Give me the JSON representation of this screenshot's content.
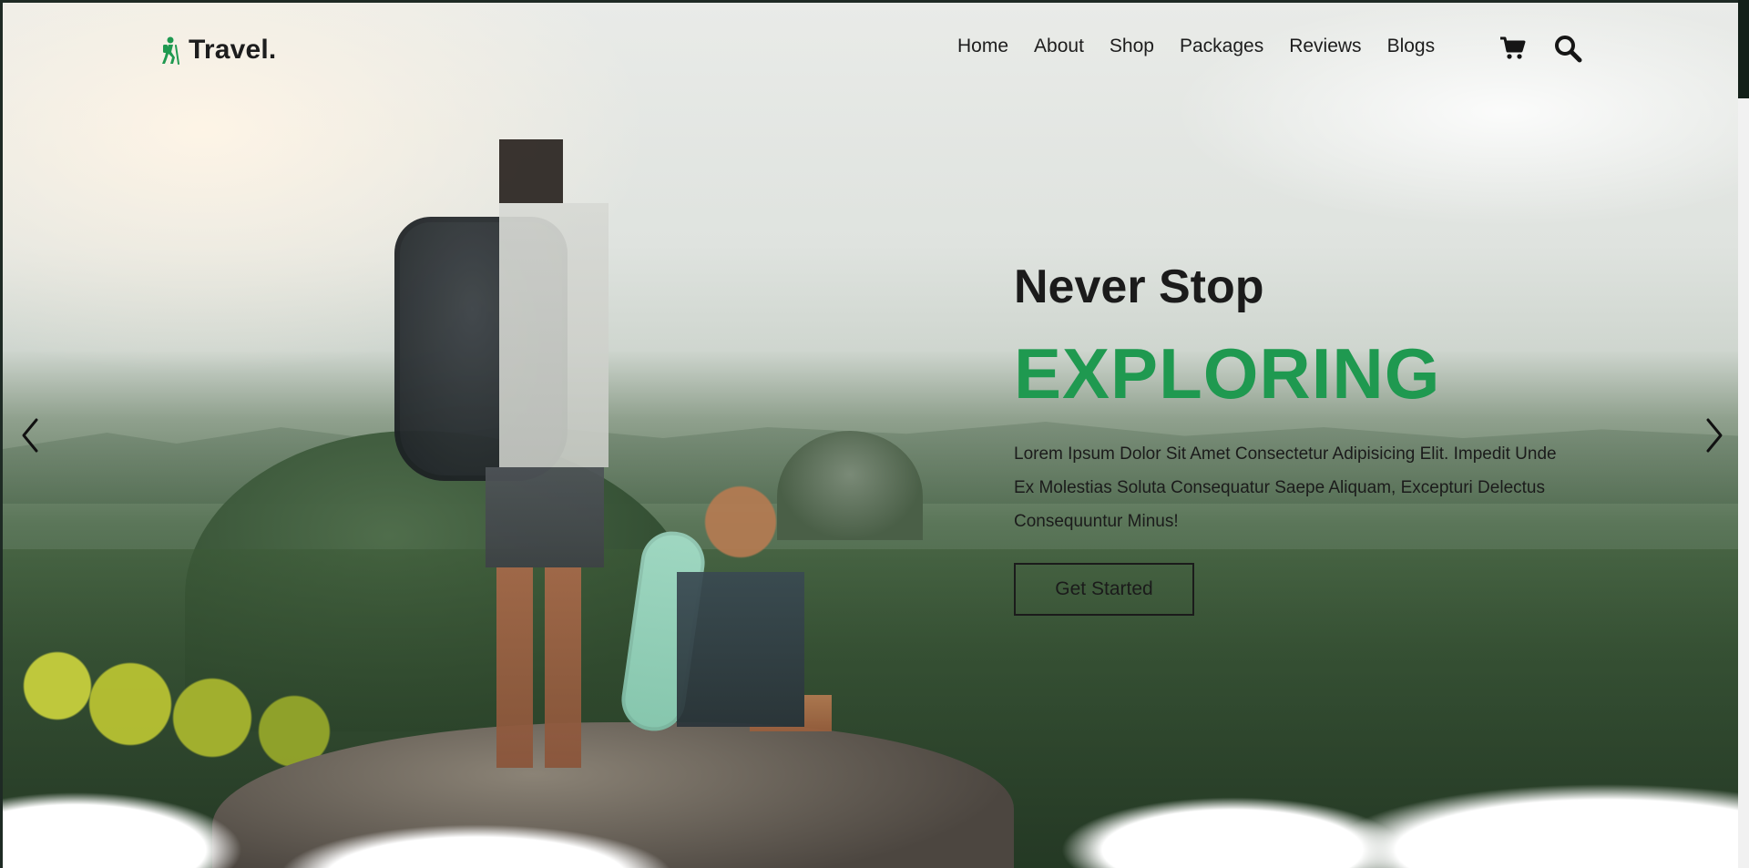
{
  "brand": {
    "name": "Travel.",
    "accent_color": "#1f9950",
    "logo_icon": "hiker-icon"
  },
  "nav": {
    "items": [
      "Home",
      "About",
      "Shop",
      "Packages",
      "Reviews",
      "Blogs"
    ],
    "icons": [
      "shopping-cart-icon",
      "search-icon"
    ]
  },
  "hero": {
    "subtitle": "Never Stop",
    "title": "EXPLORING",
    "description": "Lorem Ipsum Dolor Sit Amet Consectetur Adipisicing Elit. Impedit Unde Ex Molestias Soluta Consequatur Saepe Aliquam, Excepturi Delectus Consequuntur Minus!",
    "cta_label": "Get Started"
  },
  "slider": {
    "prev_icon": "chevron-left-icon",
    "next_icon": "chevron-right-icon"
  }
}
